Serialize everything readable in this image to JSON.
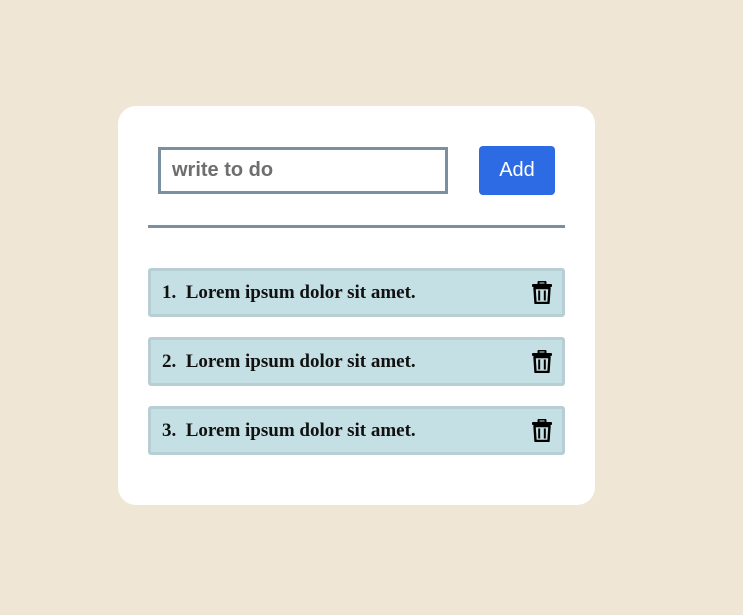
{
  "input": {
    "placeholder": "write to do",
    "value": ""
  },
  "add_button": {
    "label": "Add"
  },
  "todos": [
    {
      "number": "1.",
      "text": "Lorem ipsum dolor sit amet.",
      "icon": "trash-icon"
    },
    {
      "number": "2.",
      "text": "Lorem ipsum dolor sit amet.",
      "icon": "trash-icon"
    },
    {
      "number": "3.",
      "text": "Lorem ipsum dolor sit amet.",
      "icon": "trash-icon"
    }
  ],
  "colors": {
    "background": "#f0e6d6",
    "card": "#ffffff",
    "accent": "#2d6be4",
    "item_background": "#c5e0e4",
    "border": "#7c8f9e"
  }
}
